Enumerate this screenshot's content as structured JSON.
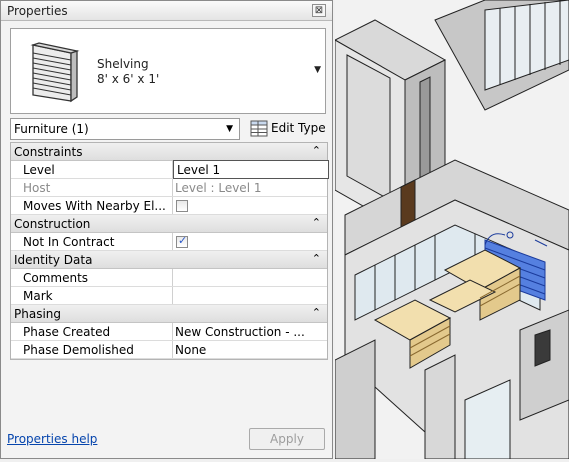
{
  "palette": {
    "title": "Properties",
    "close_glyph": "⊠"
  },
  "type_selector": {
    "thumbnail_icon": "shelving-icon",
    "family": "Shelving",
    "type": "8' x 6' x 1'"
  },
  "instance_filter": {
    "value": "Furniture (1)"
  },
  "edit_type": {
    "label": "Edit Type",
    "icon": "edit-type-icon"
  },
  "groups": [
    {
      "name": "Constraints"
    },
    {
      "name": "Construction"
    },
    {
      "name": "Identity Data"
    },
    {
      "name": "Phasing"
    }
  ],
  "properties": {
    "level": {
      "name": "Level",
      "value": "Level 1"
    },
    "host": {
      "name": "Host",
      "value": "Level : Level 1"
    },
    "moves": {
      "name": "Moves With Nearby El...",
      "checked": false
    },
    "not_in_contract": {
      "name": "Not In Contract",
      "checked": true
    },
    "comments": {
      "name": "Comments",
      "value": ""
    },
    "mark": {
      "name": "Mark",
      "value": ""
    },
    "phase_created": {
      "name": "Phase Created",
      "value": "New Construction - ..."
    },
    "phase_demolished": {
      "name": "Phase Demolished",
      "value": "None"
    }
  },
  "footer": {
    "help_link": "Properties help",
    "apply_label": "Apply"
  },
  "collapse_glyph": "⌃"
}
